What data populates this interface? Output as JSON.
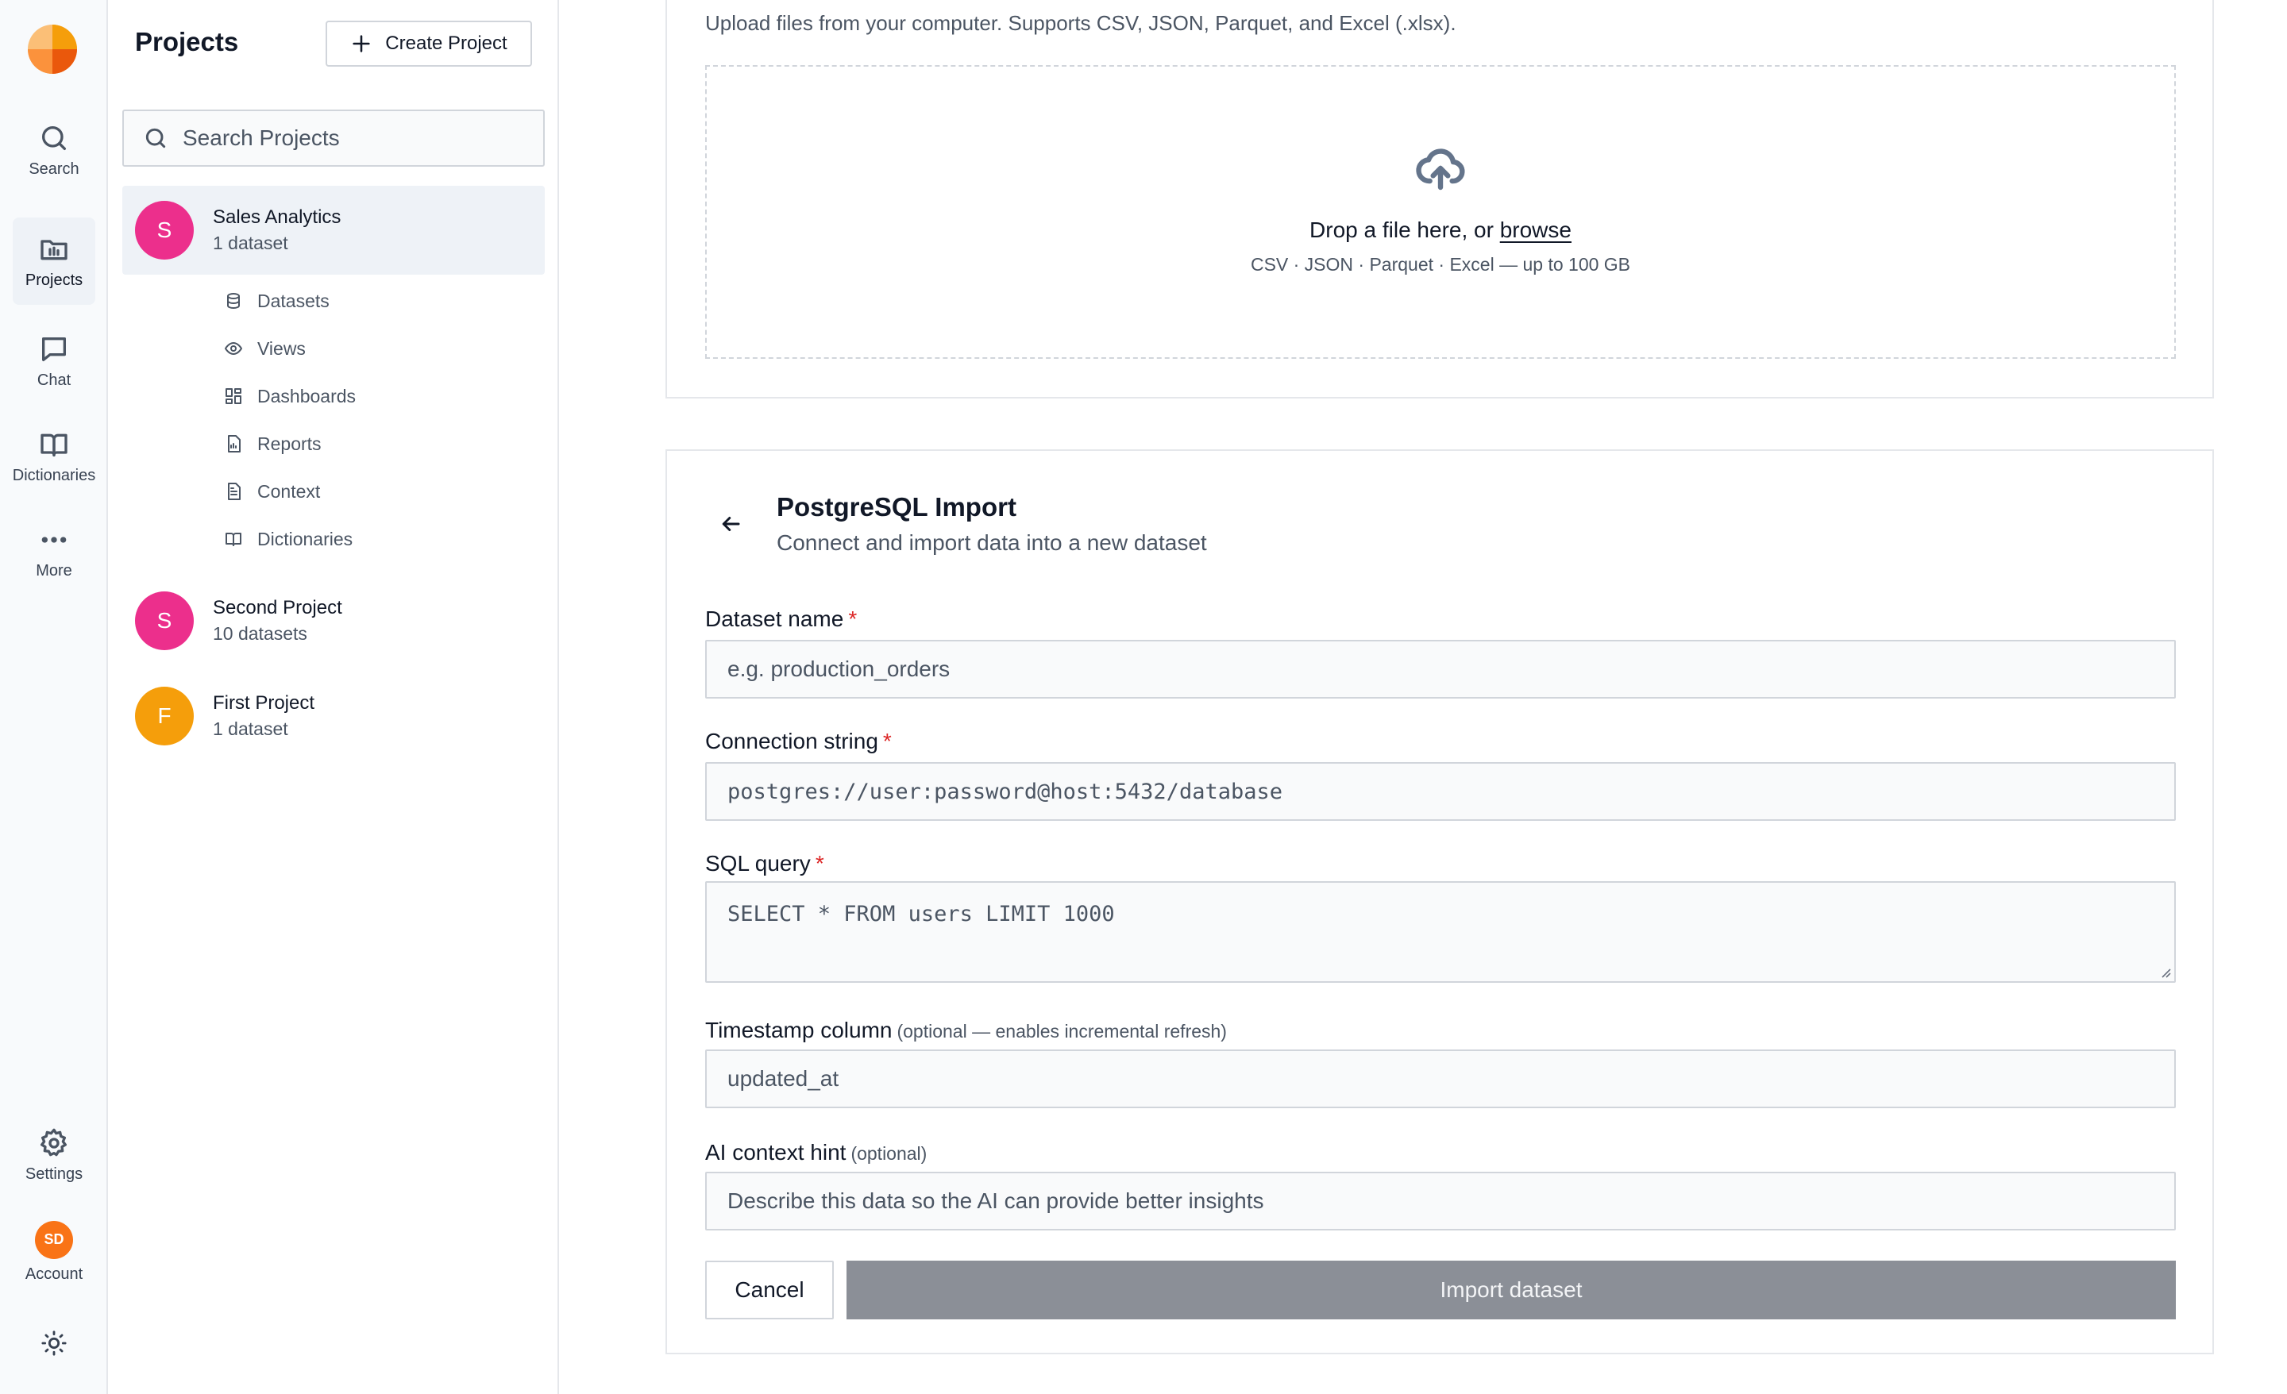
{
  "rail": {
    "items": [
      {
        "label": "Search",
        "icon": "search-icon"
      },
      {
        "label": "Projects",
        "icon": "folder-icon"
      },
      {
        "label": "Chat",
        "icon": "chat-icon"
      },
      {
        "label": "Dictionaries",
        "icon": "book-icon"
      },
      {
        "label": "More",
        "icon": "more-icon"
      }
    ],
    "settings_label": "Settings",
    "account_label": "Account",
    "account_initials": "SD"
  },
  "projects_panel": {
    "title": "Projects",
    "create_label": "Create Project",
    "search_placeholder": "Search Projects",
    "projects": [
      {
        "initial": "S",
        "name": "Sales Analytics",
        "meta": "1 dataset",
        "color": "#ec2f8c"
      },
      {
        "initial": "S",
        "name": "Second Project",
        "meta": "10 datasets",
        "color": "#ec2f8c"
      },
      {
        "initial": "F",
        "name": "First Project",
        "meta": "1 dataset",
        "color": "#f59e0b"
      }
    ],
    "subitems": [
      {
        "label": "Datasets",
        "icon": "database-icon"
      },
      {
        "label": "Views",
        "icon": "eye-icon"
      },
      {
        "label": "Dashboards",
        "icon": "dashboard-icon"
      },
      {
        "label": "Reports",
        "icon": "report-icon"
      },
      {
        "label": "Context",
        "icon": "document-icon"
      },
      {
        "label": "Dictionaries",
        "icon": "book-icon"
      }
    ]
  },
  "upload": {
    "description": "Upload files from your computer. Supports CSV, JSON, Parquet, and Excel (.xlsx).",
    "drop_text": "Drop a file here, or",
    "browse_label": "browse",
    "formats": "CSV · JSON · Parquet · Excel — up to 100 GB"
  },
  "postgres": {
    "title": "PostgreSQL Import",
    "subtitle": "Connect and import data into a new dataset",
    "dataset_name_label": "Dataset name",
    "dataset_name_placeholder": "e.g. production_orders",
    "connection_label": "Connection string",
    "connection_placeholder": "postgres://user:password@host:5432/database",
    "sql_label": "SQL query",
    "sql_placeholder": "SELECT * FROM users LIMIT 1000",
    "timestamp_label": "Timestamp column",
    "timestamp_hint": "(optional — enables incremental refresh)",
    "timestamp_placeholder": "updated_at",
    "context_label": "AI context hint",
    "context_hint": "(optional)",
    "context_placeholder": "Describe this data so the AI can provide better insights",
    "required_mark": "*",
    "cancel_label": "Cancel",
    "import_label": "Import dataset"
  },
  "colors": {
    "accent_pink": "#ec2f8c",
    "accent_orange": "#f59e0b",
    "account_orange": "#f97316",
    "import_disabled": "#8b8f97",
    "required_red": "#dc2626"
  }
}
